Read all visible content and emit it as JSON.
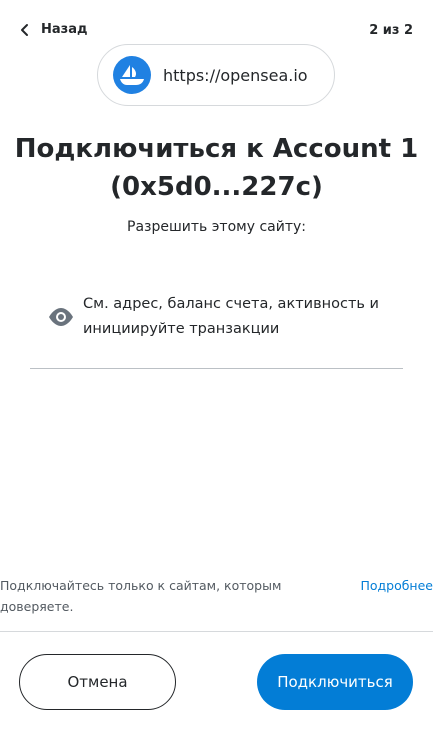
{
  "header": {
    "back_label": "Назад",
    "step_label": "2 из 2"
  },
  "site": {
    "url": "https://opensea.io",
    "logo_icon": "opensea-logo-icon",
    "logo_color": "#2081e2"
  },
  "title": "Подключиться к Account 1 (0x5d0...227c)",
  "subtitle": "Разрешить этому сайту:",
  "permission": {
    "icon": "eye-icon",
    "text": "См. адрес, баланс счета, активность и инициируйте транзакции"
  },
  "footer": {
    "trust_text": "Подключайтесь только к сайтам, которым доверяете.",
    "more_label": "Подробнее"
  },
  "buttons": {
    "cancel_label": "Отмена",
    "connect_label": "Подключиться",
    "connect_color": "#037dd6"
  }
}
